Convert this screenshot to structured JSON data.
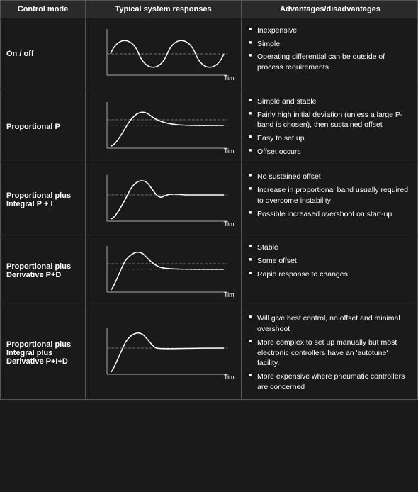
{
  "header": {
    "col1": "Control mode",
    "col2": "Typical system responses",
    "col3": "Advantages/disadvantages"
  },
  "rows": [
    {
      "mode": "On / off",
      "chart_type": "sine",
      "advantages": [
        "Inexpensive",
        "Simple",
        "Operating differential can be outside of process requirements"
      ]
    },
    {
      "mode": "Proportional P",
      "chart_type": "overdamp_high",
      "advantages": [
        "Simple and stable",
        "Fairly high initial deviation (unless a large P-band is chosen), then sustained offset",
        "Easy to set up",
        "Offset occurs"
      ]
    },
    {
      "mode": "Proportional plus Integral P + I",
      "chart_type": "pi",
      "advantages": [
        "No sustained offset",
        "Increase in proportional band usually required to overcome instability",
        "Possible increased overshoot on start-up"
      ]
    },
    {
      "mode": "Proportional plus Derivative P+D",
      "chart_type": "pd",
      "advantages": [
        "Stable",
        "Some offset",
        "Rapid response to changes"
      ]
    },
    {
      "mode": "Proportional plus Integral plus Derivative P+I+D",
      "chart_type": "pid",
      "advantages": [
        "Will give best control, no offset and minimal overshoot",
        "More complex to set up manually but most electronic controllers have an 'autotune' facility.",
        "More expensive where pneumatic controllers are concerned"
      ]
    }
  ]
}
